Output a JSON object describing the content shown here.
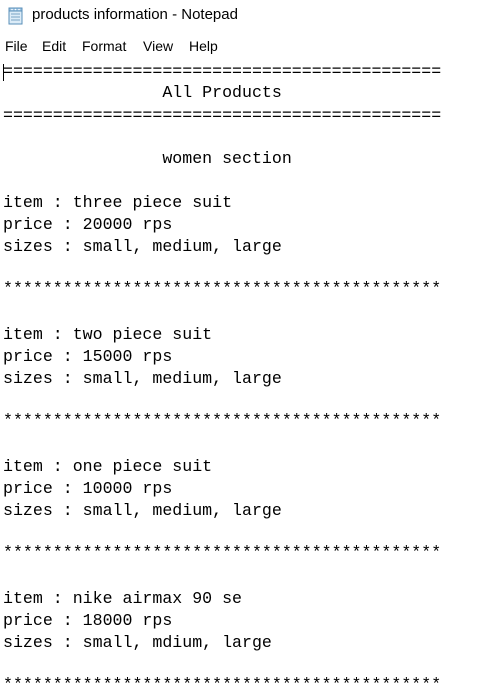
{
  "window": {
    "title": "products information - Notepad",
    "app_icon": "notepad-icon"
  },
  "menu": {
    "items": [
      "File",
      "Edit",
      "Format",
      "View",
      "Help"
    ]
  },
  "document": {
    "border_line": "============================================",
    "heading": "                All Products",
    "section": "                women section",
    "separator": "********************************************",
    "products": [
      {
        "item": "item : three piece suit",
        "price": "price : 20000 rps",
        "sizes": "sizes : small, medium, large"
      },
      {
        "item": "item : two piece suit",
        "price": "price : 15000 rps",
        "sizes": "sizes : small, medium, large"
      },
      {
        "item": "item : one piece suit",
        "price": "price : 10000 rps",
        "sizes": "sizes : small, medium, large"
      },
      {
        "item": "item : nike airmax 90 se",
        "price": "price : 18000 rps",
        "sizes": "sizes : small, mdium, large"
      }
    ]
  }
}
